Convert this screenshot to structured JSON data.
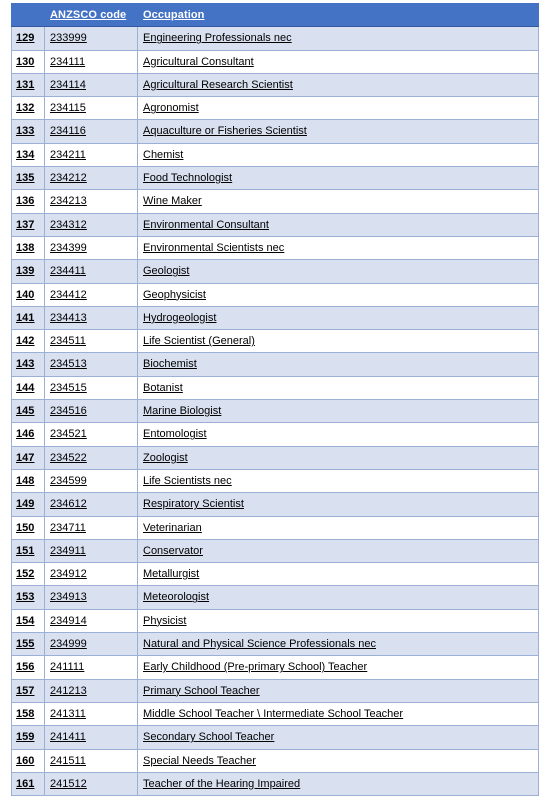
{
  "table": {
    "columns": [
      {
        "key": "index",
        "label": ""
      },
      {
        "key": "anzsco_code",
        "label": "ANZSCO code"
      },
      {
        "key": "occupation",
        "label": "Occupation"
      }
    ],
    "colors": {
      "header_background": "#4472C4",
      "header_text": "#FFFFFF",
      "row_shade": "#D9E0F0",
      "row_plain": "#FFFFFF",
      "border": "#9BB0D4",
      "cell_text": "#000000"
    },
    "rows": [
      {
        "index": "129",
        "anzsco_code": "233999",
        "occupation": "Engineering Professionals nec"
      },
      {
        "index": "130",
        "anzsco_code": "234111",
        "occupation": "Agricultural Consultant"
      },
      {
        "index": "131",
        "anzsco_code": "234114",
        "occupation": "Agricultural Research Scientist"
      },
      {
        "index": "132",
        "anzsco_code": "234115",
        "occupation": "Agronomist"
      },
      {
        "index": "133",
        "anzsco_code": "234116",
        "occupation": "Aquaculture or Fisheries Scientist"
      },
      {
        "index": "134",
        "anzsco_code": "234211",
        "occupation": "Chemist"
      },
      {
        "index": "135",
        "anzsco_code": "234212",
        "occupation": "Food Technologist"
      },
      {
        "index": "136",
        "anzsco_code": "234213",
        "occupation": "Wine Maker"
      },
      {
        "index": "137",
        "anzsco_code": "234312",
        "occupation": "Environmental Consultant"
      },
      {
        "index": "138",
        "anzsco_code": "234399",
        "occupation": "Environmental Scientists nec"
      },
      {
        "index": "139",
        "anzsco_code": "234411",
        "occupation": "Geologist"
      },
      {
        "index": "140",
        "anzsco_code": "234412",
        "occupation": "Geophysicist"
      },
      {
        "index": "141",
        "anzsco_code": "234413",
        "occupation": "Hydrogeologist"
      },
      {
        "index": "142",
        "anzsco_code": "234511",
        "occupation": "Life Scientist (General)"
      },
      {
        "index": "143",
        "anzsco_code": "234513",
        "occupation": "Biochemist"
      },
      {
        "index": "144",
        "anzsco_code": "234515",
        "occupation": "Botanist"
      },
      {
        "index": "145",
        "anzsco_code": "234516",
        "occupation": "Marine Biologist"
      },
      {
        "index": "146",
        "anzsco_code": "234521",
        "occupation": "Entomologist"
      },
      {
        "index": "147",
        "anzsco_code": "234522",
        "occupation": "Zoologist"
      },
      {
        "index": "148",
        "anzsco_code": "234599",
        "occupation": "Life Scientists nec"
      },
      {
        "index": "149",
        "anzsco_code": "234612",
        "occupation": "Respiratory Scientist"
      },
      {
        "index": "150",
        "anzsco_code": "234711",
        "occupation": "Veterinarian"
      },
      {
        "index": "151",
        "anzsco_code": "234911",
        "occupation": "Conservator"
      },
      {
        "index": "152",
        "anzsco_code": "234912",
        "occupation": "Metallurgist"
      },
      {
        "index": "153",
        "anzsco_code": "234913",
        "occupation": "Meteorologist"
      },
      {
        "index": "154",
        "anzsco_code": "234914",
        "occupation": "Physicist"
      },
      {
        "index": "155",
        "anzsco_code": "234999",
        "occupation": "Natural and Physical Science Professionals nec"
      },
      {
        "index": "156",
        "anzsco_code": "241111",
        "occupation": "Early Childhood (Pre-primary School) Teacher"
      },
      {
        "index": "157",
        "anzsco_code": "241213",
        "occupation": "Primary School Teacher"
      },
      {
        "index": "158",
        "anzsco_code": "241311",
        "occupation": "Middle School Teacher \\ Intermediate School Teacher"
      },
      {
        "index": "159",
        "anzsco_code": "241411",
        "occupation": "Secondary School Teacher"
      },
      {
        "index": "160",
        "anzsco_code": "241511",
        "occupation": "Special Needs Teacher"
      },
      {
        "index": "161",
        "anzsco_code": "241512",
        "occupation": "Teacher of the Hearing Impaired"
      }
    ]
  }
}
